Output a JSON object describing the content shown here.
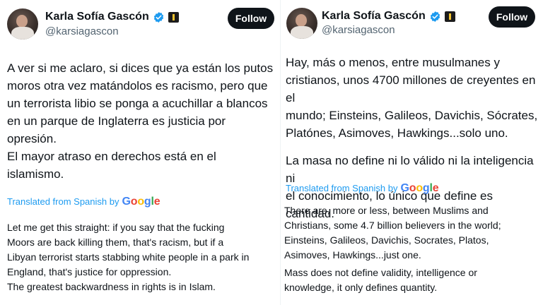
{
  "left": {
    "author": {
      "display_name": "Karla Sofía Gascón",
      "handle": "@karsiagascon"
    },
    "follow_label": "Follow",
    "text_lines": [
      "A ver si me aclaro, si dices que ya están los putos",
      "moros otra vez matándolos es racismo, pero que",
      "un terrorista libio se ponga a acuchillar a blancos",
      "en un parque de Inglaterra es justicia por",
      "opresión.",
      "El mayor atraso en derechos está en el",
      "islamismo."
    ],
    "translated_label": "Translated from Spanish by",
    "google_letters": [
      "G",
      "o",
      "o",
      "g",
      "l",
      "e"
    ],
    "translation_lines": [
      "Let me get this straight: if you say that the fucking",
      "Moors are back killing them, that's racism, but if a",
      "Libyan terrorist starts stabbing white people in a park in",
      "England, that's justice for oppression.",
      "The greatest backwardness in rights is in Islam."
    ]
  },
  "right": {
    "author": {
      "display_name": "Karla Sofía Gascón",
      "handle": "@karsiagascon"
    },
    "follow_label": "Follow",
    "text_para1": [
      "Hay, más o menos, entre musulmanes y",
      "cristianos, unos 4700 millones de creyentes en el",
      "mundo; Einsteins, Galileos, Davichis, Sócrates,",
      "Platónes, Asimoves, Hawkings...solo uno."
    ],
    "text_para2": [
      "La masa no define ni lo válido ni la inteligencia ni",
      "el conocimiento, lo único que define es cantidad."
    ],
    "translated_label": "Translated from Spanish by",
    "google_letters": [
      "G",
      "o",
      "o",
      "g",
      "l",
      "e"
    ],
    "translation_para1": [
      "There are, more or less, between Muslims and",
      "Christians, some 4.7 billion believers in the world;",
      "Einsteins, Galileos, Davichis, Socrates, Platos,",
      "Asimoves, Hawkings...just one."
    ],
    "translation_para2": [
      "Mass does not define validity, intelligence or",
      "knowledge, it only defines quantity."
    ]
  },
  "colors": {
    "link_blue": "#1d9bf0",
    "verified_blue": "#1d9bf0",
    "text": "#0f1419",
    "muted": "#536471",
    "follow_bg": "#0f1419"
  },
  "icons": [
    "verified-badge-icon",
    "affiliate-badge-icon",
    "google-logo"
  ]
}
